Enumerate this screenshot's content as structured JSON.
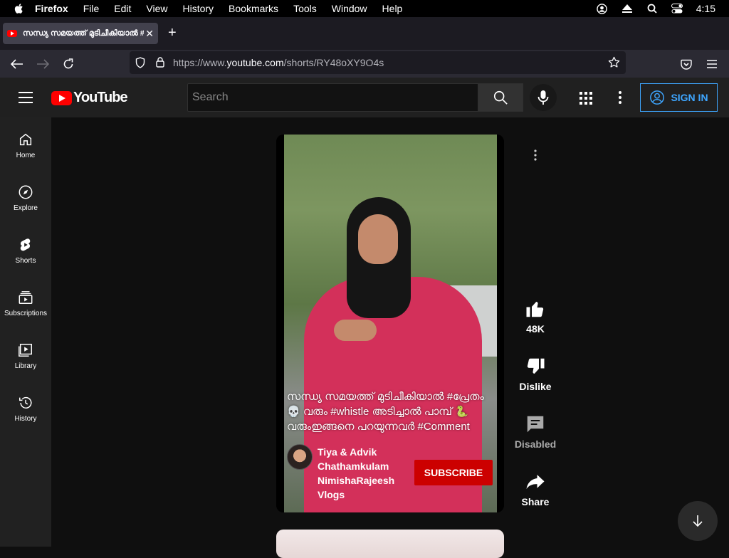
{
  "menubar": {
    "app_name": "Firefox",
    "items": [
      "File",
      "Edit",
      "View",
      "History",
      "Bookmarks",
      "Tools",
      "Window",
      "Help"
    ],
    "clock": "4:15"
  },
  "browser": {
    "tab_title": "സന്ധ്യ സമയത്ത് മുടിചീകിയാൽ #",
    "url_prefix": "https://www.",
    "url_domain": "youtube.com",
    "url_path": "/shorts/RY48oXY9O4s"
  },
  "youtube": {
    "logo_text": "YouTube",
    "search_placeholder": "Search",
    "sign_in": "SIGN IN",
    "sidebar": [
      {
        "label": "Home",
        "icon": "home-icon"
      },
      {
        "label": "Explore",
        "icon": "explore-icon"
      },
      {
        "label": "Shorts",
        "icon": "shorts-icon"
      },
      {
        "label": "Subscriptions",
        "icon": "subscriptions-icon"
      },
      {
        "label": "Library",
        "icon": "library-icon"
      },
      {
        "label": "History",
        "icon": "history-icon"
      }
    ],
    "short": {
      "caption": "സന്ധ്യ സമയത്ത് മുടിചീകിയാൽ #പ്രേതം 💀 വരും #whistle അടിച്ചാൽ പാമ്പ് 🐍 വരുംഇങ്ങനെ പറയുന്നവർ #Comment",
      "channel_name": "Tiya & Advik Chathamkulam NimishaRajeesh Vlogs",
      "subscribe": "SUBSCRIBE"
    },
    "actions": {
      "like_count": "48K",
      "dislike_label": "Dislike",
      "comments_label": "Disabled",
      "share_label": "Share"
    }
  },
  "colors": {
    "accent_blue": "#3ea6ff",
    "subscribe_red": "#cc0000",
    "youtube_red": "#ff0000"
  }
}
